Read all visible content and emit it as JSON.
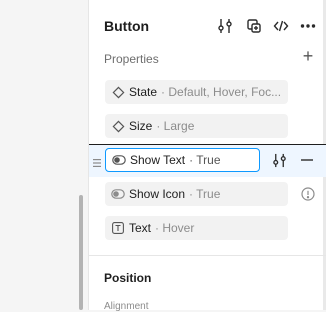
{
  "panel": {
    "title": "Button",
    "properties_label": "Properties",
    "properties": [
      {
        "name": "State",
        "value": "· Default, Hover, Foc...",
        "icon": "variant-diamond-icon"
      },
      {
        "name": "Size",
        "value": "· Large",
        "icon": "variant-diamond-icon"
      },
      {
        "name": "Show Text",
        "value": "· True",
        "icon": "boolean-toggle-icon",
        "selected": true
      },
      {
        "name": "Show Icon",
        "value": "· True",
        "icon": "boolean-toggle-icon"
      },
      {
        "name": "Text",
        "value": "· Hover",
        "icon": "text-property-icon"
      }
    ],
    "position_label": "Position",
    "alignment_label": "Alignment"
  },
  "colors": {
    "accent": "#0d99ff",
    "selection_bg": "#eef6ff",
    "field_bg": "#f2f2f2"
  }
}
